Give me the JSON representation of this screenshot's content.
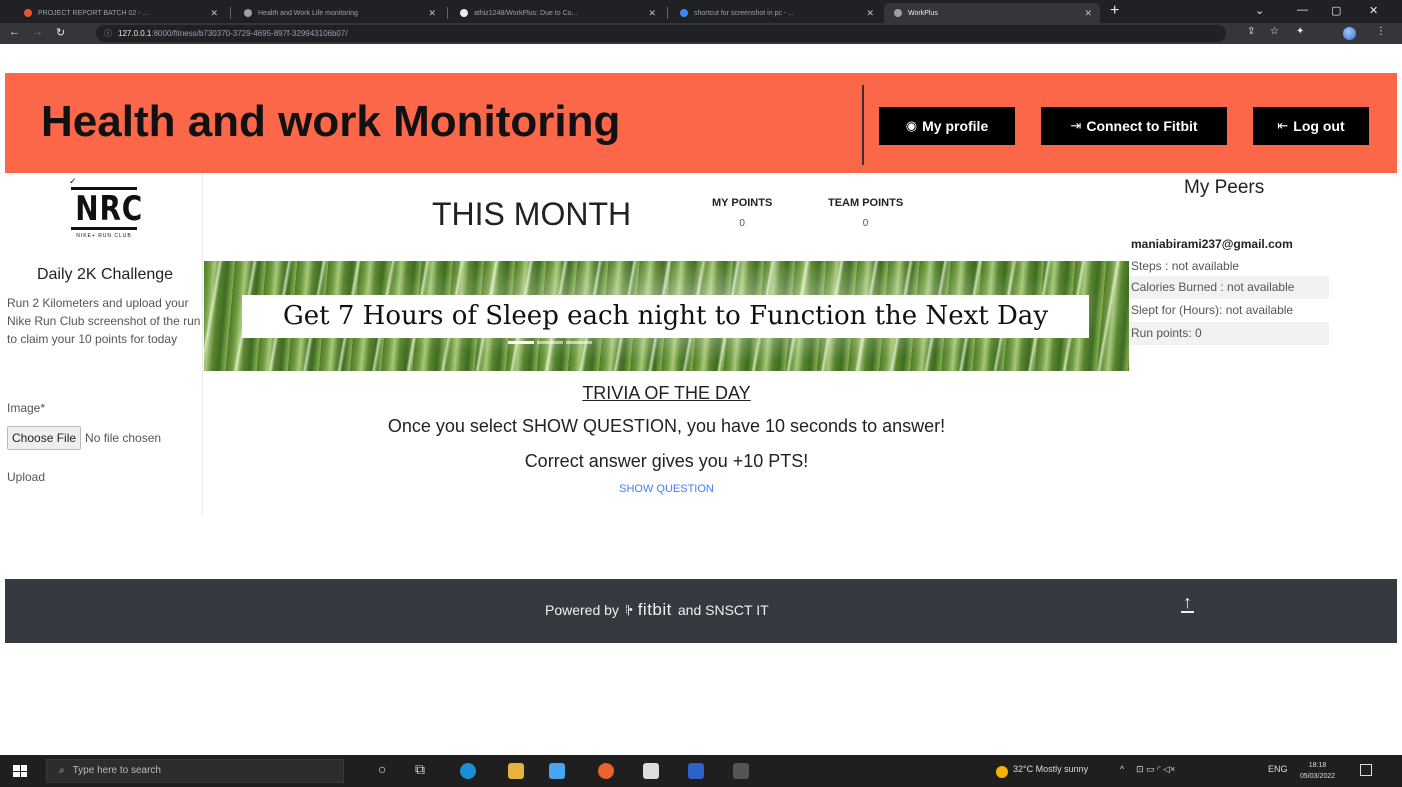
{
  "browser": {
    "tabs": [
      {
        "title": "PROJECT REPORT BATCH 02 - ...",
        "favicon_color": "#e8543a"
      },
      {
        "title": "Health and Work Life monitoring",
        "favicon_color": "#9aa0a6"
      },
      {
        "title": "athiz1248/WorkPlus: Due to Co...",
        "favicon_color": "#e8eaed"
      },
      {
        "title": "shortcut for screenshot in pc - ...",
        "favicon_color": "#4285f4"
      },
      {
        "title": "WorkPlus",
        "favicon_color": "#9aa0a6"
      }
    ],
    "active_tab": 4,
    "url_host": "127.0.0.1",
    "url_path": ":8000/fitness/b730370-3729-4695-897f-329943106b07/"
  },
  "header": {
    "title": "Health and work Monitoring",
    "profile_label": "My profile",
    "fitbit_label": "Connect to Fitbit",
    "logout_label": "Log out"
  },
  "left": {
    "logo_text": "NRC",
    "logo_subtext": "NIKE+ RUN CLUB",
    "challenge_title": "Daily 2K Challenge",
    "challenge_desc": "Run 2 Kilometers and upload your Nike Run Club screenshot of the run to claim your 10 points for today",
    "image_label": "Image*",
    "choose_file_label": "Choose File",
    "no_file_text": "No file chosen",
    "upload_label": "Upload"
  },
  "main": {
    "month_title": "THIS MONTH",
    "my_points_label": "MY POINTS",
    "my_points_value": "0",
    "team_points_label": "TEAM POINTS",
    "team_points_value": "0",
    "banner_caption": "Get 7 Hours of Sleep each night to Function the Next Day",
    "trivia_title": "TRIVIA OF THE DAY",
    "trivia_line1": "Once you select SHOW QUESTION, you have 10 seconds to answer!",
    "trivia_line2": "Correct answer gives you +10 PTS!",
    "show_question_label": "SHOW QUESTION"
  },
  "peers": {
    "title": "My Peers",
    "email": "maniabirami237@gmail.com",
    "steps": "Steps : not available",
    "calories": "Calories Burned : not available",
    "slept": "Slept for (Hours): not available",
    "run_points": "Run points: 0"
  },
  "footer": {
    "powered_by": "Powered by",
    "fitbit": "fitbit",
    "and_text": "and SNSCT IT"
  },
  "taskbar": {
    "search_placeholder": "Type here to search",
    "weather": "32°C  Mostly sunny",
    "lang": "ENG",
    "time": "18:18",
    "date": "05/03/2022"
  }
}
